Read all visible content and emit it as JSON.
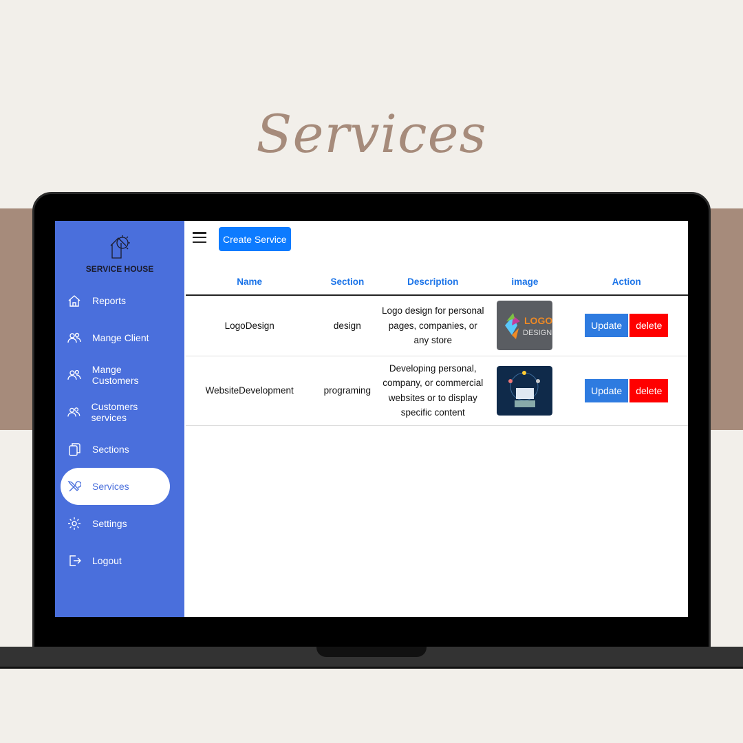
{
  "page_title": "Services",
  "app": {
    "brand": "SERVICE HOUSE"
  },
  "sidebar": {
    "items": [
      {
        "label": "Reports",
        "icon": "home-icon"
      },
      {
        "label": "Mange Client",
        "icon": "users-icon"
      },
      {
        "label": "Mange Customers",
        "icon": "users-icon"
      },
      {
        "label": "Customers services",
        "icon": "users-icon"
      },
      {
        "label": "Sections",
        "icon": "copy-icon"
      },
      {
        "label": "Services",
        "icon": "tools-icon",
        "active": true
      },
      {
        "label": "Settings",
        "icon": "gear-icon"
      },
      {
        "label": "Logout",
        "icon": "logout-icon"
      }
    ]
  },
  "toolbar": {
    "create_label": "Create Service"
  },
  "table": {
    "headers": [
      "Name",
      "Section",
      "Description",
      "image",
      "Action"
    ],
    "rows": [
      {
        "name": "LogoDesign",
        "section": "design",
        "description": "Logo design for personal pages, companies, or any store",
        "update": "Update",
        "delete": "delete"
      },
      {
        "name": "WebsiteDevelopment",
        "section": "programing",
        "description": "Developing personal, company, or commercial websites or to display specific content",
        "update": "Update",
        "delete": "delete"
      }
    ]
  },
  "colors": {
    "sidebar": "#4a6fdc",
    "accent": "#0d7bff",
    "danger": "#ff0000",
    "title": "#a68b7b"
  }
}
